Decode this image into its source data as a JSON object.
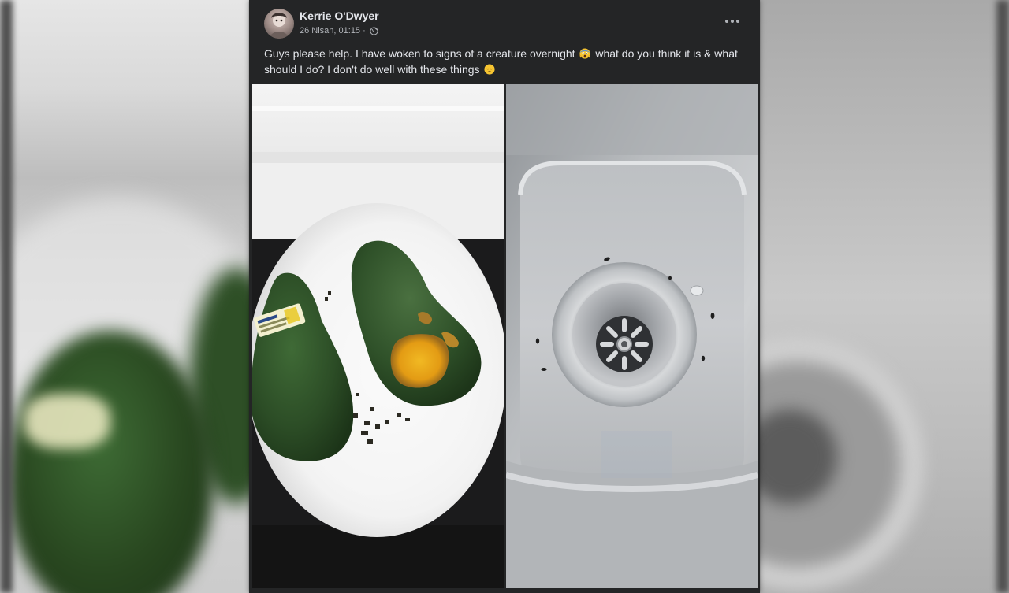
{
  "post": {
    "author": "Kerrie O'Dwyer",
    "date": "26 Nisan, 01:15",
    "separator": "·",
    "privacy_icon": "globe-icon",
    "menu_icon": "more-horizontal-icon",
    "text_part1": "Guys please help. I have woken to signs of a creature overnight",
    "emoji1": "scream-face-emoji",
    "text_part2": "what do you think it is & what should I do? I don't do well with these things",
    "emoji2": "disappointed-face-emoji"
  },
  "photos": [
    {
      "name": "avocados-on-plate-photo"
    },
    {
      "name": "sink-drain-photo"
    }
  ],
  "colors": {
    "card_bg": "#242526",
    "primary_text": "#e4e6eb",
    "secondary_text": "#b0b3b8"
  }
}
